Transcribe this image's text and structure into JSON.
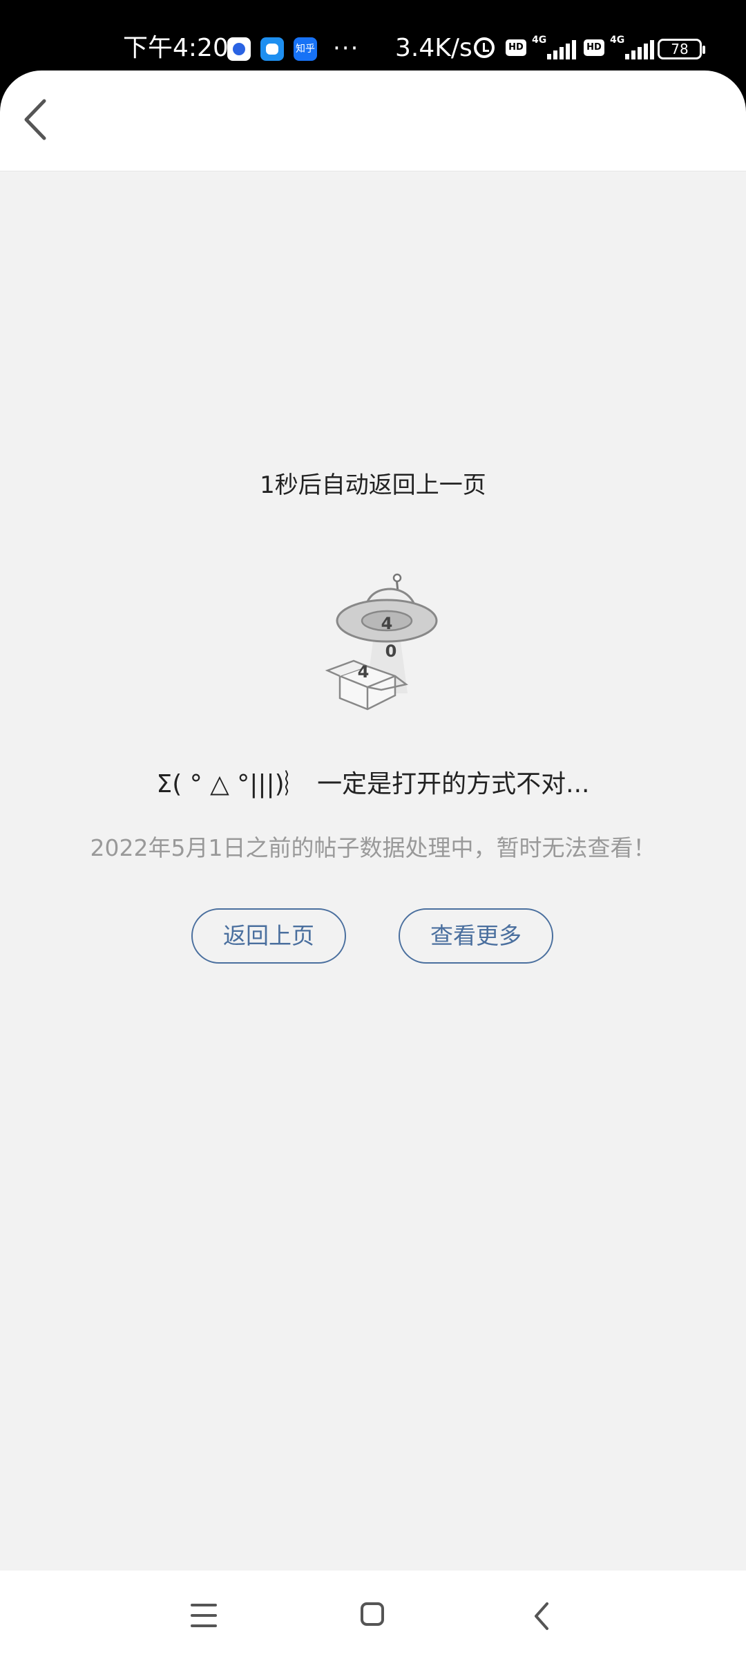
{
  "status_bar": {
    "time": "下午4:20",
    "app_icons": [
      "baidu-icon",
      "mail-icon",
      "zhihu-icon"
    ],
    "zhihu_label": "知乎",
    "more": "···",
    "net_speed": "3.4K/s",
    "hd1": "HD",
    "sig1": "4G",
    "hd2": "HD",
    "sig2": "4G",
    "battery": "78"
  },
  "header": {
    "back_icon": "chevron-left-icon"
  },
  "main": {
    "countdown": "1秒后自动返回上一页",
    "illustration": {
      "digits": [
        "4",
        "0",
        "4"
      ]
    },
    "headline": "Σ( ° △ °|||)︴ 一定是打开的方式不对...",
    "subtext": "2022年5月1日之前的帖子数据处理中，暂时无法查看！",
    "back_button": "返回上页",
    "more_button": "查看更多"
  },
  "nav_bar": {
    "icons": [
      "menu-icon",
      "home-icon",
      "back-icon"
    ]
  },
  "colors": {
    "accent": "#4a6f9e",
    "page_background": "#f2f2f2",
    "subtext": "#999999"
  }
}
